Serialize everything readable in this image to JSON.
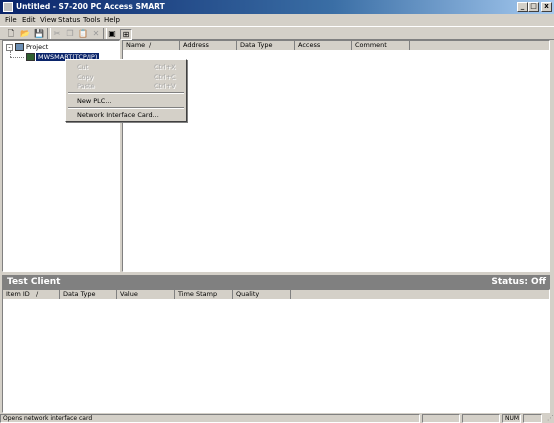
{
  "window": {
    "title": "Untitled - S7-200 PC Access SMART",
    "min": "_",
    "max": "□",
    "close": "x"
  },
  "menu": [
    "File",
    "Edit",
    "View",
    "Status",
    "Tools",
    "Help"
  ],
  "toolbar": {
    "icons": [
      "new-icon",
      "open-icon",
      "save-icon",
      "cut-icon",
      "copy-icon",
      "paste-icon",
      "delete-icon",
      "properties-icon",
      "test-client-icon"
    ]
  },
  "tree": {
    "root": "Project",
    "child": "MWSMART(TCP/IP)",
    "expander": "-"
  },
  "items_table": {
    "columns": [
      "Name",
      "Address",
      "Data Type",
      "Access",
      "Comment"
    ],
    "sort_marker": "/"
  },
  "context_menu": {
    "cut": "Cut",
    "cut_key": "Ctrl+X",
    "copy": "Copy",
    "copy_key": "Ctrl+C",
    "paste": "Paste",
    "paste_key": "Ctrl+V",
    "new_plc": "New PLC...",
    "network": "Network Interface Card..."
  },
  "test_client": {
    "title": "Test Client",
    "status": "Status: Off",
    "columns": [
      "Item ID",
      "Data Type",
      "Value",
      "Time Stamp",
      "Quality"
    ],
    "sort_marker": "/"
  },
  "statusbar": {
    "message": "Opens network interface card",
    "num": "NUM"
  },
  "colors": {
    "title_start": "#0a246a",
    "title_end": "#a6caf0",
    "selection": "#0a246a",
    "test_client_bar": "#808080",
    "chrome": "#d4d0c8"
  }
}
